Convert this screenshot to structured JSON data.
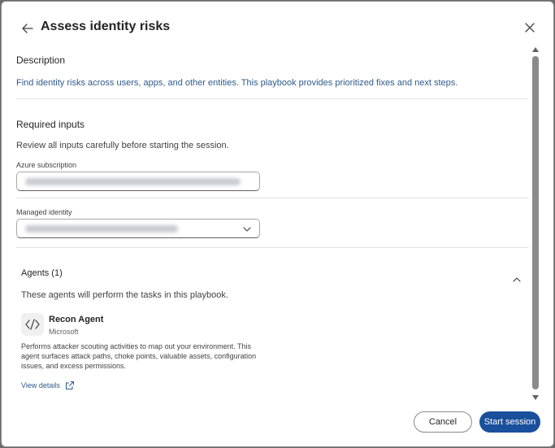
{
  "dialog": {
    "title": "Assess identity risks",
    "icons": {
      "back": "arrow-left-icon",
      "close": "close-icon"
    }
  },
  "description": {
    "label": "Description",
    "text": "Find identity risks across users, apps, and other entities. This playbook provides prioritized fixes and next steps."
  },
  "required_inputs": {
    "label": "Required inputs",
    "hint": "Review all inputs carefully before starting the session.",
    "azure_subscription": {
      "label": "Azure subscription"
    },
    "managed_identity": {
      "label": "Managed identity"
    }
  },
  "agents": {
    "title": "Agents (1)",
    "subtitle": "These agents will perform the tasks in this playbook.",
    "items": [
      {
        "name": "Recon Agent",
        "vendor": "Microsoft",
        "description": "Performs attacker scouting activities to map out your environment. This agent surfaces attack paths, choke points, valuable assets, configuration issues, and excess permissions.",
        "link": "View details"
      }
    ]
  },
  "footer": {
    "cancel": "Cancel",
    "start": "Start session"
  },
  "colors": {
    "primary": "#1a4f9c",
    "link": "#2f5a8a"
  }
}
